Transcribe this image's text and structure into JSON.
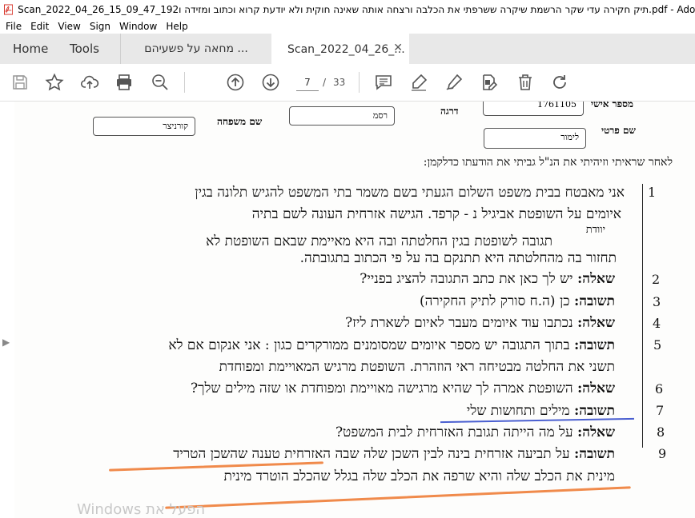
{
  "window": {
    "title": "Scan_2022_04_26_15_09_47_192תיק חקירה עדי שקר הרשמת שיקרה ששרפתי את הכלבה ורצחה אותה שאינה חוקית ולא יודעת קרוא וכתוב ומזידה ו.pdf - Adobe Acrobat"
  },
  "menu": [
    "File",
    "Edit",
    "View",
    "Sign",
    "Window",
    "Help"
  ],
  "tabs": {
    "home": "Home",
    "tools": "Tools",
    "doc1": "מחאה על פשעיהם ...",
    "doc2": "Scan_2022_04_26_..."
  },
  "toolbar": {
    "page_current": "7",
    "page_separator": "/",
    "page_total": "33"
  },
  "form": {
    "id_label": "מספר אישי",
    "id_value": "1761105",
    "rank_label": "דרגה",
    "rank_value": "רסמ",
    "lastname_label": "שם משפחה",
    "lastname_value": "קורניצר",
    "firstname_label": "שם פרטי",
    "firstname_value": "לימור"
  },
  "intro": "לאחר שראיתי וזיהיתי את הנ\"ל גביתי את הודעתו כדלקמן:",
  "numbers": [
    "1",
    "2",
    "3",
    "4",
    "5",
    "6",
    "7",
    "8",
    "9"
  ],
  "lines": [
    "אני מאבטח בבית משפט השלום הגעתי בשם משמר בתי המשפט להגיש תלונה בגין",
    "איומים על השופטת אביגיל נ - קרפד. הגישה אזרחית העונה לשם בתיה",
    "תגובה לשופטת בגין החלטתה ובה היא מאיימת שבאם השופטת לא",
    "תחזור בה מהחלטתה היא תתנקם בה על פי הכתוב בתגובתה.",
    "שאלה: יש לך כאן את כתב התגובה להציג בפניי?",
    "תשובה: כן (ה.ח סורק לתיק החקירה)",
    "שאלה: נכתבו עוד איומים מעבר לאיום לשארת ליז?",
    "תשובה: בתוך התגובה יש מספר איומים שמסומנים ממורקרים כגון : אני אנקום אם לא",
    "תשני את החלטה מבטיחה ראי הוזהרת. השופטת מרגיש המאויימת ומפוחדת",
    "שאלה: השופטת אמרה לך שהיא מרגישה מאויימת ומפוחדת או שזה מילים שלך?",
    "תשובה: מילים ותחושות שלי",
    "שאלה: על מה הייתה תגובת האזרחית לבית המשפט?",
    "תשובה: על תביעה אזרחית בינה לבין השכן שלה שבה האזרחית טענה שהשכן הטריד",
    "מינית את הכלב שלה והיא שרפה את הכלב שלה בגלל שהכלב הוטרד מינית"
  ],
  "partial_word": "יוודת",
  "watermark": "Windows הפעל את"
}
